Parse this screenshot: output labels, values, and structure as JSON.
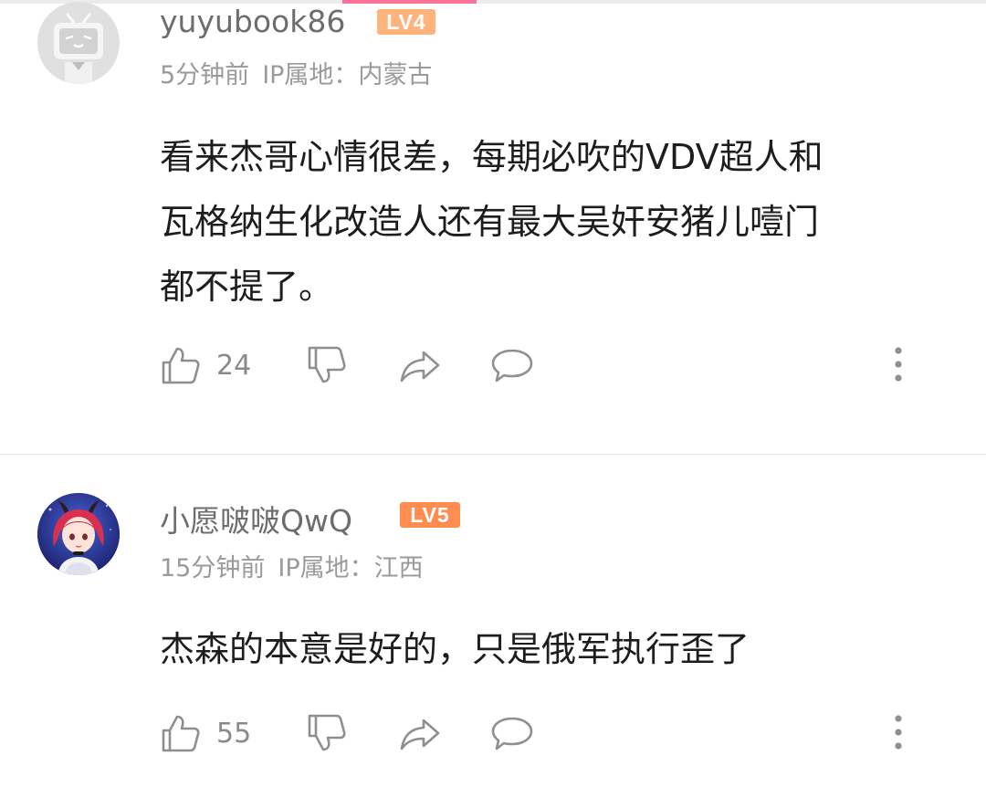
{
  "comments": [
    {
      "username": "yuyubook86",
      "level": "LV4",
      "level_color": "#ffb37c",
      "time": "5分钟前",
      "ip_location": "IP属地：内蒙古",
      "content_lines": [
        "看来杰哥心情很差，每期必吹的VDV超人和",
        "瓦格纳生化改造人还有最大吴奸安猪儿噎门",
        "都不提了。"
      ],
      "likes": "24",
      "avatar": "default-tv-avatar"
    },
    {
      "username": "小愿啵啵QwQ",
      "level": "LV5",
      "level_color": "#ff8c50",
      "time": "15分钟前",
      "ip_location": "IP属地：江西",
      "content_lines": [
        "杰森的本意是好的，只是俄军执行歪了"
      ],
      "likes": "55",
      "avatar": "anime-girl-avatar"
    }
  ],
  "icons": [
    "like-icon",
    "dislike-icon",
    "share-icon",
    "reply-icon",
    "more-icon"
  ],
  "accent": "#fb7299"
}
